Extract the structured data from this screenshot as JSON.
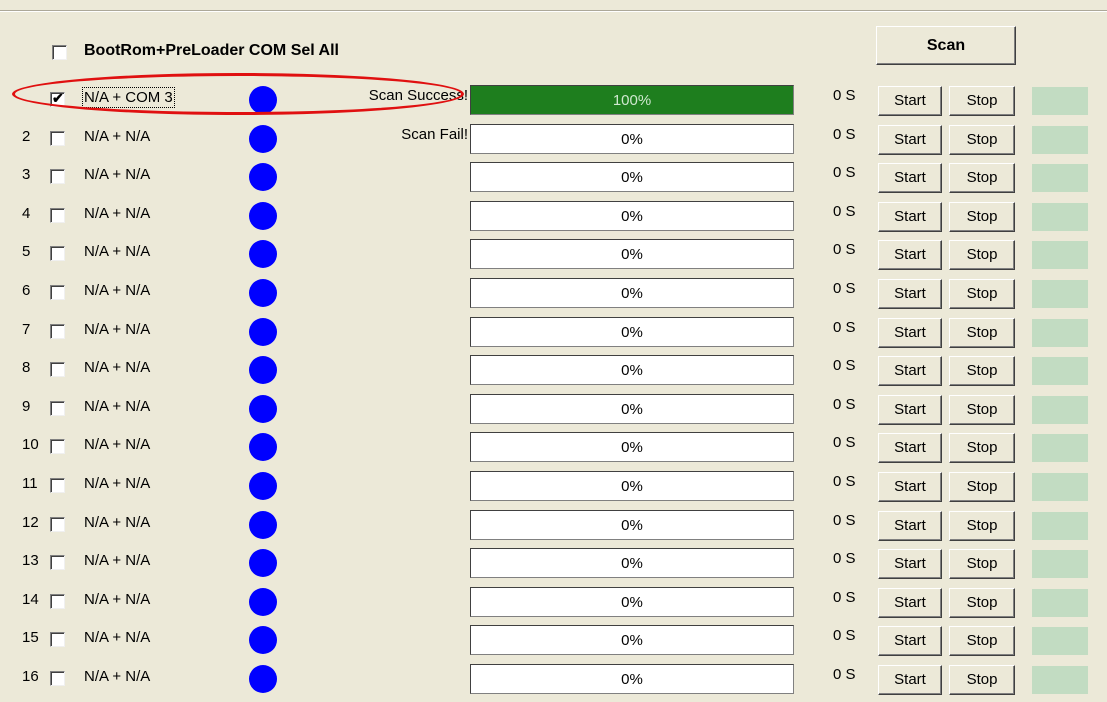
{
  "header": {
    "select_all_label": "BootRom+PreLoader COM Sel All",
    "select_all_checked": false,
    "scan_button_label": "Scan"
  },
  "colors": {
    "indicator_dot": "#0000ff",
    "progress_fill": "#1e7e1e",
    "status_led": "#c2dcc2",
    "annotation_ellipse": "#e01010"
  },
  "rows": [
    {
      "num": "",
      "checked": true,
      "port": "N/A + COM 3",
      "status": "Scan Success!",
      "progress": "100%",
      "progress_fraction": 1.0,
      "time": "0 S",
      "start_label": "Start",
      "stop_label": "Stop"
    },
    {
      "num": "2",
      "checked": false,
      "port": "N/A + N/A",
      "status": "Scan Fail!",
      "progress": "0%",
      "progress_fraction": 0,
      "time": "0 S",
      "start_label": "Start",
      "stop_label": "Stop"
    },
    {
      "num": "3",
      "checked": false,
      "port": "N/A + N/A",
      "status": "",
      "progress": "0%",
      "progress_fraction": 0,
      "time": "0 S",
      "start_label": "Start",
      "stop_label": "Stop"
    },
    {
      "num": "4",
      "checked": false,
      "port": "N/A + N/A",
      "status": "",
      "progress": "0%",
      "progress_fraction": 0,
      "time": "0 S",
      "start_label": "Start",
      "stop_label": "Stop"
    },
    {
      "num": "5",
      "checked": false,
      "port": "N/A + N/A",
      "status": "",
      "progress": "0%",
      "progress_fraction": 0,
      "time": "0 S",
      "start_label": "Start",
      "stop_label": "Stop"
    },
    {
      "num": "6",
      "checked": false,
      "port": "N/A + N/A",
      "status": "",
      "progress": "0%",
      "progress_fraction": 0,
      "time": "0 S",
      "start_label": "Start",
      "stop_label": "Stop"
    },
    {
      "num": "7",
      "checked": false,
      "port": "N/A + N/A",
      "status": "",
      "progress": "0%",
      "progress_fraction": 0,
      "time": "0 S",
      "start_label": "Start",
      "stop_label": "Stop"
    },
    {
      "num": "8",
      "checked": false,
      "port": "N/A + N/A",
      "status": "",
      "progress": "0%",
      "progress_fraction": 0,
      "time": "0 S",
      "start_label": "Start",
      "stop_label": "Stop"
    },
    {
      "num": "9",
      "checked": false,
      "port": "N/A + N/A",
      "status": "",
      "progress": "0%",
      "progress_fraction": 0,
      "time": "0 S",
      "start_label": "Start",
      "stop_label": "Stop"
    },
    {
      "num": "10",
      "checked": false,
      "port": "N/A + N/A",
      "status": "",
      "progress": "0%",
      "progress_fraction": 0,
      "time": "0 S",
      "start_label": "Start",
      "stop_label": "Stop"
    },
    {
      "num": "11",
      "checked": false,
      "port": "N/A + N/A",
      "status": "",
      "progress": "0%",
      "progress_fraction": 0,
      "time": "0 S",
      "start_label": "Start",
      "stop_label": "Stop"
    },
    {
      "num": "12",
      "checked": false,
      "port": "N/A + N/A",
      "status": "",
      "progress": "0%",
      "progress_fraction": 0,
      "time": "0 S",
      "start_label": "Start",
      "stop_label": "Stop"
    },
    {
      "num": "13",
      "checked": false,
      "port": "N/A + N/A",
      "status": "",
      "progress": "0%",
      "progress_fraction": 0,
      "time": "0 S",
      "start_label": "Start",
      "stop_label": "Stop"
    },
    {
      "num": "14",
      "checked": false,
      "port": "N/A + N/A",
      "status": "",
      "progress": "0%",
      "progress_fraction": 0,
      "time": "0 S",
      "start_label": "Start",
      "stop_label": "Stop"
    },
    {
      "num": "15",
      "checked": false,
      "port": "N/A + N/A",
      "status": "",
      "progress": "0%",
      "progress_fraction": 0,
      "time": "0 S",
      "start_label": "Start",
      "stop_label": "Stop"
    },
    {
      "num": "16",
      "checked": false,
      "port": "N/A + N/A",
      "status": "",
      "progress": "0%",
      "progress_fraction": 0,
      "time": "0 S",
      "start_label": "Start",
      "stop_label": "Stop"
    }
  ]
}
